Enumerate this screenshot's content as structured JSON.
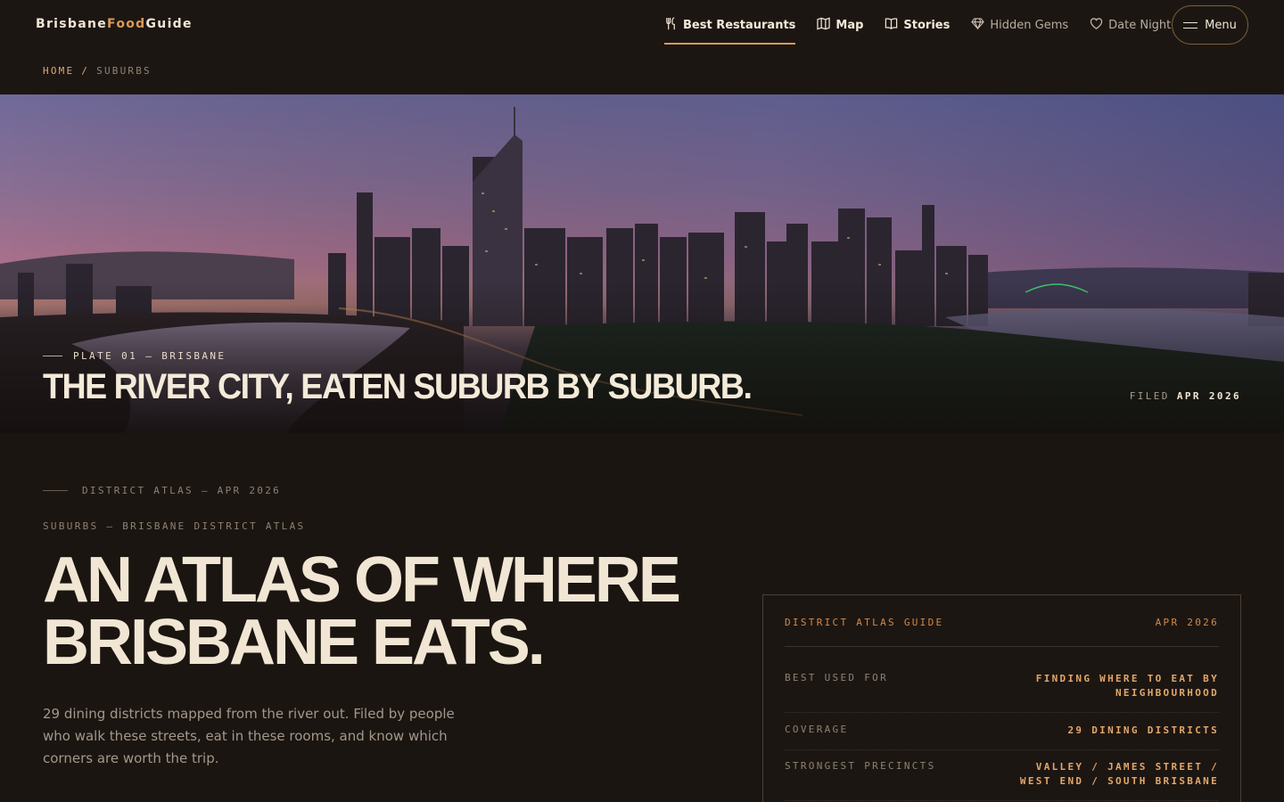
{
  "brand": {
    "part1": "Brisbane",
    "part2": "Food",
    "part3": "Guide",
    "accent_color": "#d99a56"
  },
  "nav": {
    "items": [
      {
        "label": "Best Restaurants",
        "icon": "fork-knife-icon",
        "active": true
      },
      {
        "label": "Map",
        "icon": "map-icon"
      },
      {
        "label": "Stories",
        "icon": "book-icon"
      },
      {
        "label": "Hidden Gems",
        "icon": "gem-icon"
      },
      {
        "label": "Date Night",
        "icon": "heart-icon"
      }
    ],
    "menu_label": "Menu"
  },
  "breadcrumb": {
    "home": "HOME",
    "separator": "/",
    "current": "SUBURBS"
  },
  "hero": {
    "plate": "PLATE 01 — BRISBANE",
    "title": "THE RIVER CITY, EATEN SUBURB BY SUBURB.",
    "filed_label": "FILED",
    "filed_date": "APR 2026"
  },
  "main": {
    "eyebrow": "DISTRICT ATLAS — APR 2026",
    "kicker": "SUBURBS — BRISBANE DISTRICT ATLAS",
    "title_line1": "AN ATLAS OF WHERE",
    "title_line2": "BRISBANE EATS.",
    "intro": "29 dining districts mapped from the river out. Filed by people who walk these streets, eat in these rooms, and know which corners are worth the trip."
  },
  "guide_card": {
    "title": "DISTRICT ATLAS GUIDE",
    "date": "APR 2026",
    "rows": [
      {
        "key": "BEST USED FOR",
        "value_line1": "FINDING WHERE TO EAT BY",
        "value_line2": "NEIGHBOURHOOD"
      },
      {
        "key": "COVERAGE",
        "value_line1": "29 DINING DISTRICTS",
        "value_line2": ""
      },
      {
        "key": "STRONGEST PRECINCTS",
        "value_line1": "VALLEY / JAMES STREET /",
        "value_line2": "WEST END / SOUTH BRISBANE"
      }
    ]
  }
}
